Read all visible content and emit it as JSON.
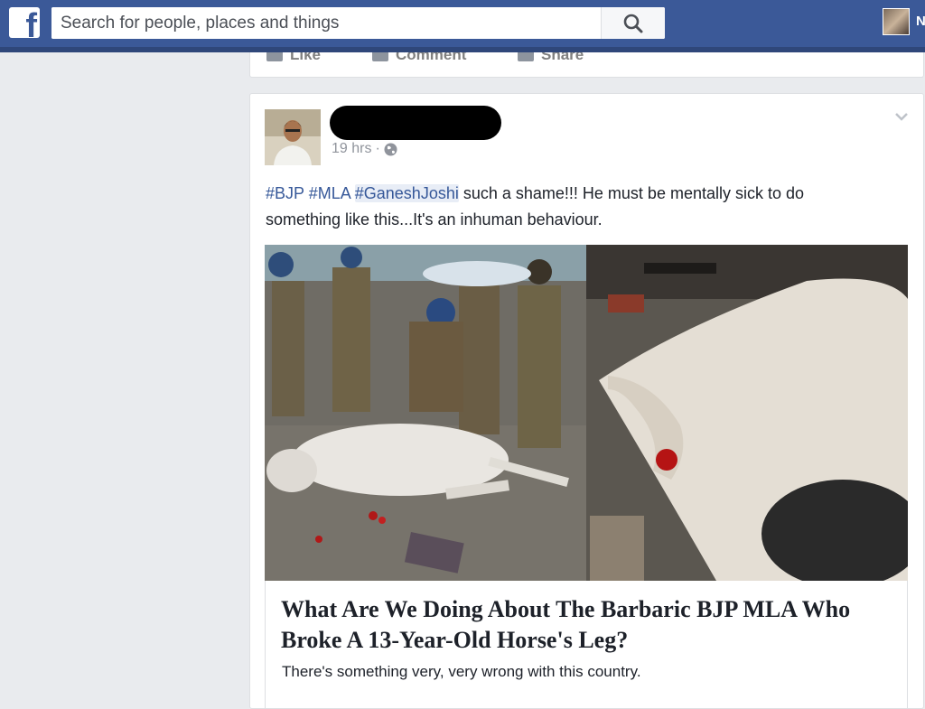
{
  "topbar": {
    "logo": "f",
    "search_placeholder": "Search for people, places and things",
    "search_icon": "search-icon",
    "user_initial": "N"
  },
  "prev_post_actions": [
    "Like",
    "Comment",
    "Share"
  ],
  "post": {
    "time": "19 hrs",
    "separator": "·",
    "privacy_icon": "globe-icon",
    "hashtags": [
      "#BJP",
      "#MLA",
      "#GaneshJoshi"
    ],
    "text_line1_rest": " such a shame!!! He must be mentally sick to do",
    "text_line2": "something like this...It's an inhuman behaviour.",
    "link_title": "What Are We Doing About The Barbaric BJP MLA Who Broke A 13-Year-Old Horse's Leg?",
    "link_description": "There's something very, very wrong with this country."
  },
  "colors": {
    "brand": "#3b5998",
    "link": "#365899",
    "page_bg": "#e9ebee"
  }
}
